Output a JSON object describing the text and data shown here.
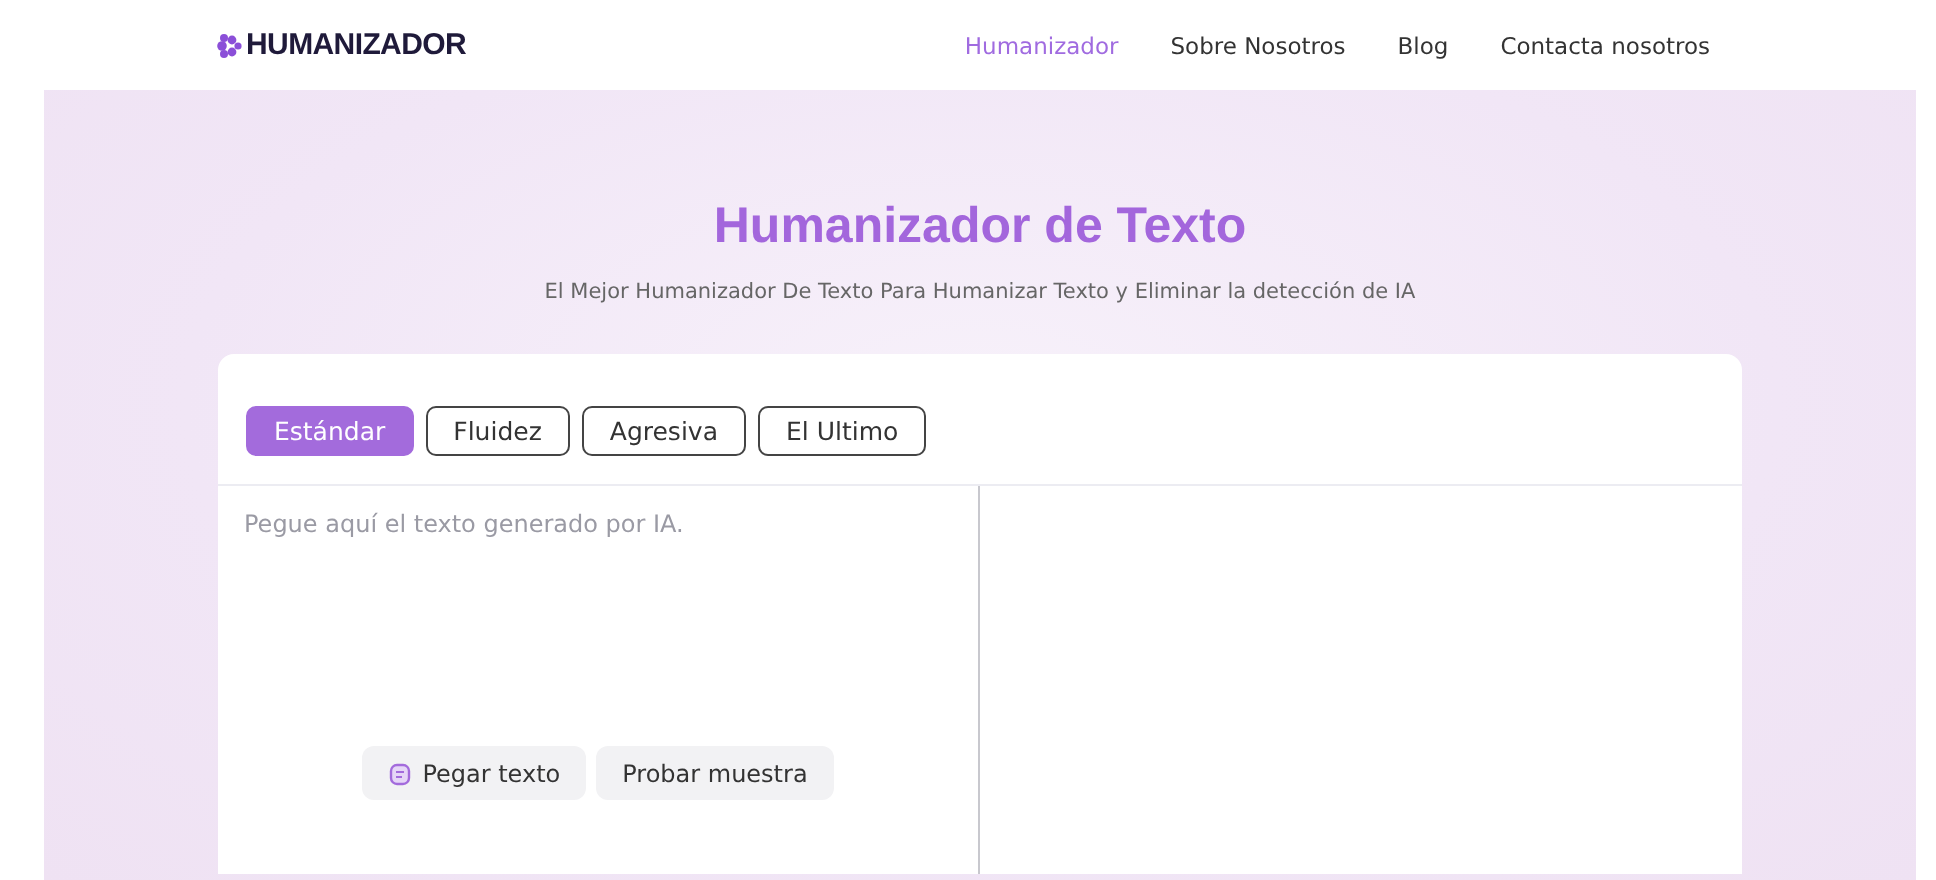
{
  "header": {
    "logo": "HUMANIZADOR",
    "nav": [
      {
        "label": "Humanizador",
        "selected": true
      },
      {
        "label": "Sobre Nosotros",
        "selected": false
      },
      {
        "label": "Blog",
        "selected": false
      },
      {
        "label": "Contacta nosotros",
        "selected": false
      }
    ]
  },
  "hero": {
    "title": "Humanizador de Texto",
    "subtitle": "El Mejor Humanizador De Texto Para Humanizar Texto y Eliminar la detección de IA"
  },
  "tabs": [
    {
      "label": "Estándar",
      "selected": true
    },
    {
      "label": "Fluidez",
      "selected": false
    },
    {
      "label": "Agresiva",
      "selected": false
    },
    {
      "label": "El Ultimo",
      "selected": false
    }
  ],
  "input": {
    "placeholder": "Pegue aquí el texto generado por IA."
  },
  "actions": [
    {
      "label": "Pegar texto",
      "kind": "paste"
    },
    {
      "label": "Probar muestra",
      "kind": "sample"
    }
  ]
}
